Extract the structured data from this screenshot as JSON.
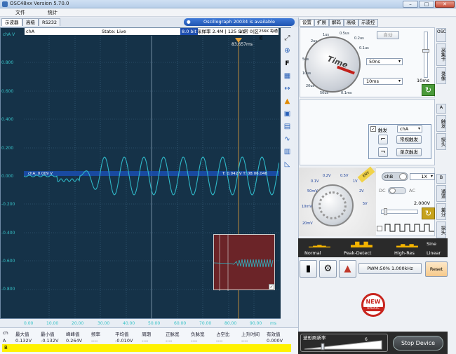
{
  "window": {
    "title": "OSC48xx  Version 5.70.0",
    "min": "–",
    "max": "□",
    "close": "✕"
  },
  "menu": [
    "文件",
    "统计"
  ],
  "tabs": [
    "示波器",
    "高级",
    "RS232"
  ],
  "banner": "Oscillograph  20034 is available",
  "status_strip": {
    "channel": "chA",
    "state": "State: Live",
    "bits": "8.0 bit",
    "rate": "采样率 2.4M | 125 S/s",
    "mode": "1|常 0|区",
    "depth": "256K 每通道"
  },
  "cursor_label": "83.657ms",
  "y_axis": {
    "title": "chA V",
    "ticks": [
      "0.800",
      "0.600",
      "0.400",
      "0.200",
      "0.000",
      "-0.200",
      "-0.400",
      "-0.600",
      "-0.800"
    ]
  },
  "x_axis": {
    "ticks": [
      "0.00",
      "10.00",
      "20.00",
      "30.00",
      "40.00",
      "50.00",
      "60.00",
      "70.00",
      "80.00",
      "90.00"
    ],
    "unit": "ms"
  },
  "trigger_labels": {
    "ch": "chA: 0.009 V",
    "time": "T: 0.042 V  T: 08:06.046"
  },
  "stats": {
    "headers": [
      "ch",
      "最大值",
      "最小值",
      "峰峰值",
      "频率",
      "平均值",
      "周期",
      "正脉宽",
      "负脉宽",
      "占空比",
      "上升时间",
      "有效值"
    ],
    "rowA": [
      "A",
      "0.132V",
      "-0.132V",
      "0.264V",
      "----",
      "-0.010V",
      "----",
      "----",
      "----",
      "----",
      "----",
      "0.000V"
    ],
    "rowB": "B"
  },
  "right_tabs": [
    "设置",
    "扩展",
    "解码",
    "高级",
    "示波控"
  ],
  "side_tabs": [
    "OSC",
    "采集卡",
    "录像",
    "A",
    "触发",
    "探头",
    "B",
    "通道",
    "差分",
    "探头"
  ],
  "timebase": {
    "auto": "自动",
    "brand": "Time",
    "dial_marks": [
      "1us",
      "0.5us",
      "0.2us",
      "0.1us",
      "2us",
      "5us",
      "10us",
      "20us",
      "50us",
      "0.1ms"
    ],
    "combo1": "50ns",
    "combo2": "10ms",
    "value": "10ms"
  },
  "trigger": {
    "enable": "触发",
    "source": "chA",
    "normal": "常规触发",
    "single": "单次触发"
  },
  "volts": {
    "channel": "chB",
    "count": "1X",
    "dc": "DC",
    "ac": "AC",
    "value": "2.000V",
    "marks": [
      "10mV",
      "20mV",
      "50mV",
      "0.1V",
      "0.2V",
      "0.5V",
      "1V",
      "2V",
      "5V"
    ],
    "range_tag": "ENV"
  },
  "capture_modes": {
    "normal": "Normal",
    "peak": "Peak-Detect",
    "hires": "High-Res",
    "sine": "Sine",
    "linear": "Linear"
  },
  "pwm": "PWM:50% 1.000kHz",
  "reset": "Reset",
  "news": {
    "line1": "NEW",
    "line2": "UPDATE"
  },
  "refresh": {
    "label": "波形刷新率",
    "value": "6"
  },
  "stop_device": "Stop Device",
  "colors": {
    "scope_bg": "#153248",
    "trace": "#2fb8c8",
    "cursor": "#e6a23a",
    "accent": "#1f55b2"
  }
}
